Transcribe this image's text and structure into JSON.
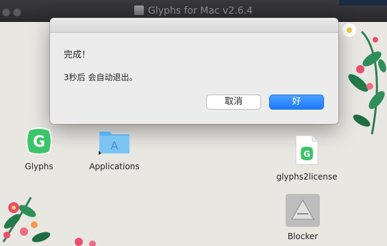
{
  "window": {
    "title": "Glyphs for Mac v2.6.4"
  },
  "dialog": {
    "title": "完成！",
    "message": "3秒后 会自动退出。",
    "cancel_label": "取消",
    "ok_label": "好"
  },
  "desktop": {
    "icons": [
      {
        "label": "Glyphs",
        "icon": "glyphs-app-icon"
      },
      {
        "label": "Applications",
        "icon": "applications-folder-icon"
      },
      {
        "label": "glyphs2license",
        "icon": "glyphs-license-file-icon"
      },
      {
        "label": "Blocker",
        "icon": "blocker-app-icon"
      }
    ]
  },
  "colors": {
    "accent": "#1f7aff",
    "desktop_background": "#e9e7e2",
    "titlebar": "#2a2a2c"
  }
}
